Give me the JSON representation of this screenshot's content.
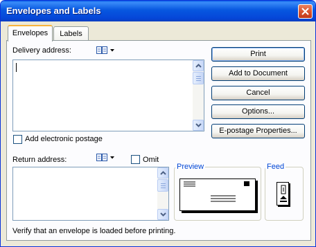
{
  "window": {
    "title": "Envelopes and Labels"
  },
  "tabs": [
    {
      "label": "Envelopes",
      "active": true
    },
    {
      "label": "Labels",
      "active": false
    }
  ],
  "delivery": {
    "label": "Delivery address:",
    "value": "",
    "electronic_postage_label": "Add electronic postage",
    "electronic_postage_checked": false
  },
  "return": {
    "label": "Return address:",
    "value": "",
    "omit_label": "Omit",
    "omit_checked": false
  },
  "buttons": {
    "print": "Print",
    "add_to_document": "Add to Document",
    "cancel": "Cancel",
    "options": "Options...",
    "epostage": "E-postage Properties..."
  },
  "preview": {
    "label": "Preview"
  },
  "feed": {
    "label": "Feed"
  },
  "status": {
    "message": "Verify that an envelope is loaded before printing."
  },
  "colors": {
    "titlebar": "#0548d8",
    "dialog_bg": "#ece9d8",
    "group_label": "#0046d5",
    "tab_highlight": "#f8b33c"
  },
  "icons": [
    "close-icon",
    "address-book-icon",
    "chevron-down-icon",
    "scroll-up-icon",
    "scroll-down-icon",
    "envelope-preview-icon",
    "feed-icon"
  ]
}
